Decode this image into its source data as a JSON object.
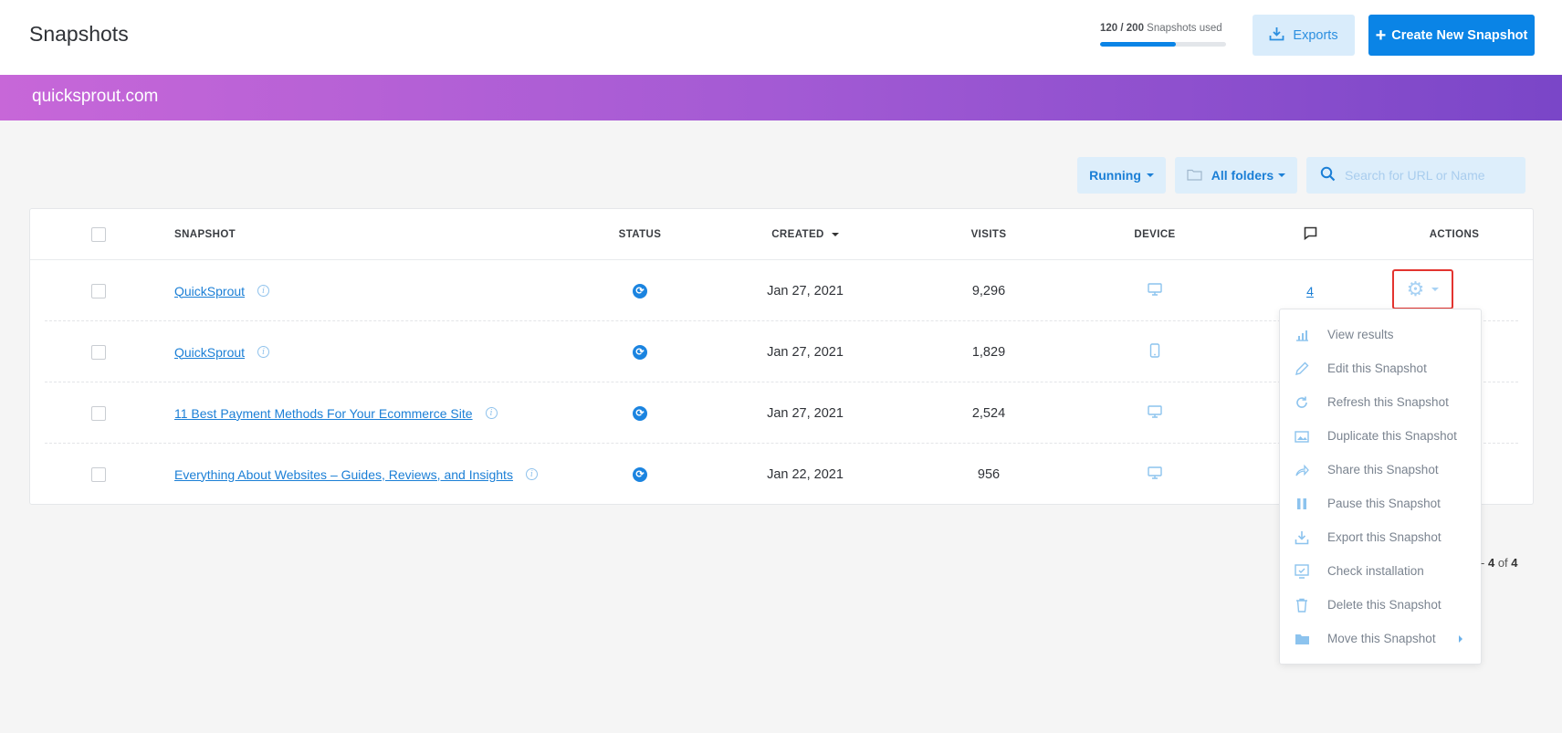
{
  "header": {
    "title": "Snapshots",
    "usage_used": "120 / 200",
    "usage_suffix": "Snapshots used",
    "usage_fraction": 0.6,
    "exports_label": "Exports",
    "create_label": "Create New Snapshot"
  },
  "banner": {
    "site": "quicksprout.com"
  },
  "filters": {
    "status_label": "Running",
    "folders_label": "All folders",
    "search_placeholder": "Search for URL or Name"
  },
  "table": {
    "columns": {
      "snapshot": "SNAPSHOT",
      "status": "STATUS",
      "created": "CREATED",
      "visits": "VISITS",
      "device": "DEVICE",
      "actions": "ACTIONS"
    },
    "rows": [
      {
        "name": "QuickSprout",
        "created": "Jan 27, 2021",
        "visits": "9,296",
        "device": "desktop",
        "comments": "4"
      },
      {
        "name": "QuickSprout",
        "created": "Jan 27, 2021",
        "visits": "1,829",
        "device": "mobile",
        "comments": ""
      },
      {
        "name": "11 Best Payment Methods For Your Ecommerce Site",
        "created": "Jan 27, 2021",
        "visits": "2,524",
        "device": "desktop",
        "comments": ""
      },
      {
        "name": "Everything About Websites – Guides, Reviews, and Insights",
        "created": "Jan 22, 2021",
        "visits": "956",
        "device": "desktop",
        "comments": ""
      }
    ]
  },
  "menu": {
    "items": [
      {
        "label": "View results",
        "icon": "bar-chart-icon"
      },
      {
        "label": "Edit this Snapshot",
        "icon": "pencil-icon"
      },
      {
        "label": "Refresh this Snapshot",
        "icon": "refresh-icon"
      },
      {
        "label": "Duplicate this Snapshot",
        "icon": "duplicate-icon"
      },
      {
        "label": "Share this Snapshot",
        "icon": "share-icon"
      },
      {
        "label": "Pause this Snapshot",
        "icon": "pause-icon"
      },
      {
        "label": "Export this Snapshot",
        "icon": "export-icon"
      },
      {
        "label": "Check installation",
        "icon": "monitor-check-icon"
      },
      {
        "label": "Delete this Snapshot",
        "icon": "trash-icon"
      },
      {
        "label": "Move this Snapshot",
        "icon": "folder-icon"
      }
    ]
  },
  "pagination": {
    "range_end": "4",
    "of": "of",
    "total": "4"
  },
  "colors": {
    "accent": "#0a84e6",
    "banner_start": "#c767d8",
    "banner_end": "#7a46c8",
    "highlight": "#e3342f"
  }
}
